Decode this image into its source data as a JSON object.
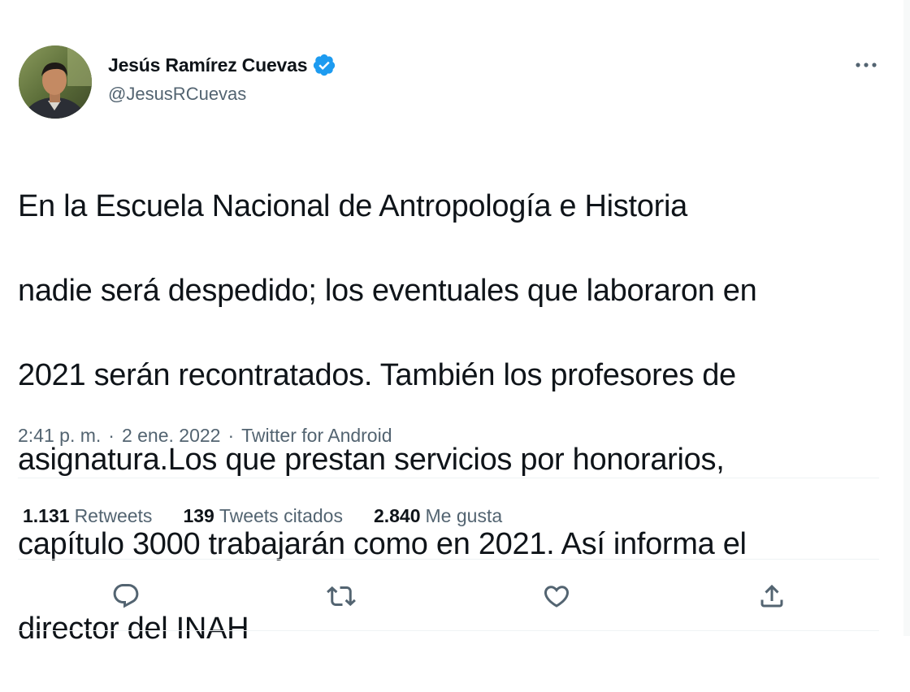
{
  "author": {
    "display_name": "Jesús Ramírez Cuevas",
    "handle": "@JesusRCuevas",
    "verified": true
  },
  "tweet": {
    "text_lines": [
      "En la Escuela Nacional de Antropología e Historia",
      "nadie será despedido; los eventuales que laboraron en",
      "2021 serán recontratados. También los profesores de",
      "asignatura.Los que prestan servicios por honorarios,",
      "capítulo 3000 trabajarán como en 2021. Así informa el",
      "director del INAH"
    ],
    "time": "2:41 p. m.",
    "separator": "·",
    "date": "2 ene. 2022",
    "source": "Twitter for Android"
  },
  "stats": {
    "retweets": {
      "count": "1.131",
      "label": "Retweets"
    },
    "quotes": {
      "count": "139",
      "label": "Tweets citados"
    },
    "likes": {
      "count": "2.840",
      "label": "Me gusta"
    }
  },
  "icons": {
    "verified": "verified-badge-icon",
    "more": "more-options-icon",
    "reply": "reply-icon",
    "retweet": "retweet-icon",
    "like": "heart-icon",
    "share": "share-icon"
  },
  "colors": {
    "text_primary": "#0f1419",
    "text_secondary": "#536471",
    "verified_blue": "#1d9bf0",
    "divider": "#eff3f4"
  }
}
